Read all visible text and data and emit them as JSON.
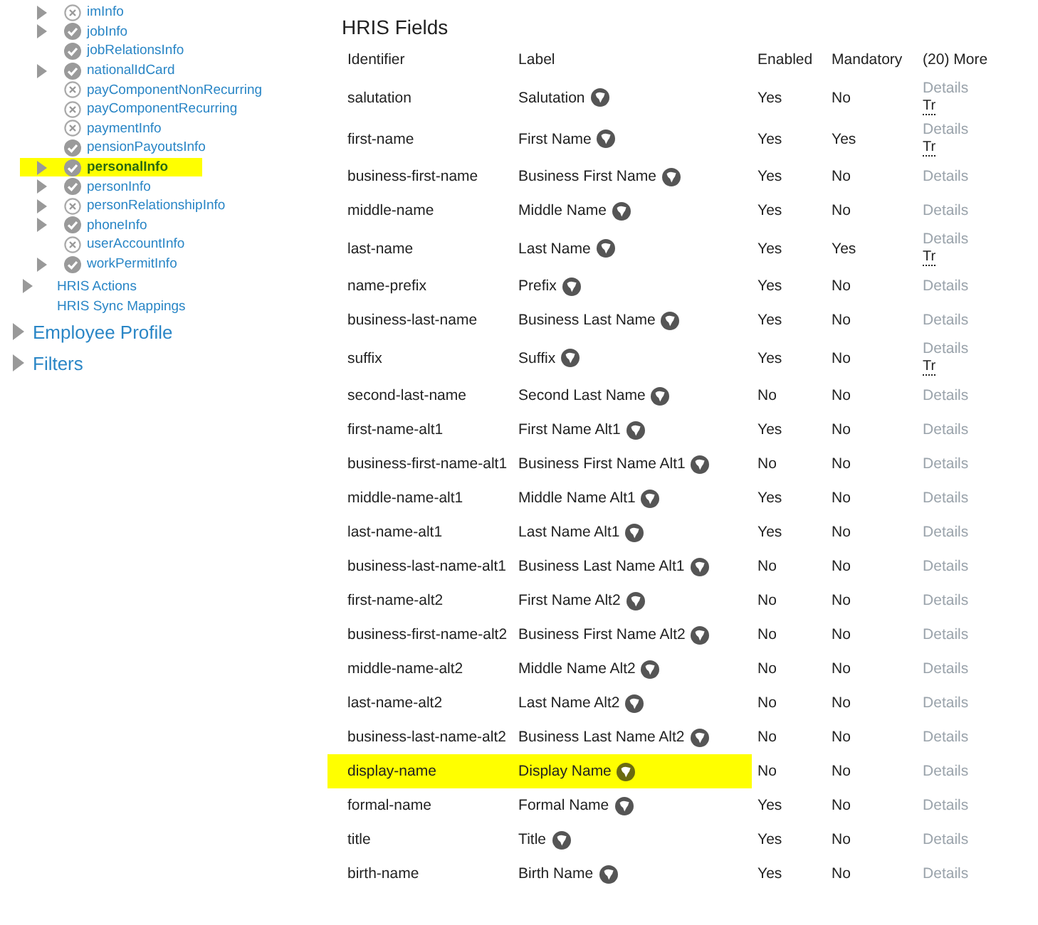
{
  "tree": {
    "entities": [
      {
        "name": "imInfo",
        "active": false,
        "expandable": true,
        "selected": false
      },
      {
        "name": "jobInfo",
        "active": true,
        "expandable": true,
        "selected": false
      },
      {
        "name": "jobRelationsInfo",
        "active": true,
        "expandable": false,
        "selected": false
      },
      {
        "name": "nationalIdCard",
        "active": true,
        "expandable": true,
        "selected": false
      },
      {
        "name": "payComponentNonRecurring",
        "active": false,
        "expandable": false,
        "selected": false
      },
      {
        "name": "payComponentRecurring",
        "active": false,
        "expandable": false,
        "selected": false
      },
      {
        "name": "paymentInfo",
        "active": false,
        "expandable": false,
        "selected": false
      },
      {
        "name": "pensionPayoutsInfo",
        "active": true,
        "expandable": false,
        "selected": false
      },
      {
        "name": "personalInfo",
        "active": true,
        "expandable": true,
        "selected": true
      },
      {
        "name": "personInfo",
        "active": true,
        "expandable": true,
        "selected": false
      },
      {
        "name": "personRelationshipInfo",
        "active": false,
        "expandable": true,
        "selected": false
      },
      {
        "name": "phoneInfo",
        "active": true,
        "expandable": true,
        "selected": false
      },
      {
        "name": "userAccountInfo",
        "active": false,
        "expandable": false,
        "selected": false
      },
      {
        "name": "workPermitInfo",
        "active": true,
        "expandable": true,
        "selected": false
      }
    ],
    "hris_items": [
      {
        "name": "HRIS Actions",
        "expandable": true
      },
      {
        "name": "HRIS Sync Mappings",
        "expandable": false
      }
    ],
    "sections": [
      {
        "name": "Employee Profile"
      },
      {
        "name": "Filters"
      }
    ]
  },
  "fields": {
    "title": "HRIS Fields",
    "columns": [
      "Identifier",
      "Label",
      "Enabled",
      "Mandatory",
      "(20) More"
    ],
    "rows": [
      {
        "identifier": "salutation",
        "label": "Salutation",
        "enabled": "Yes",
        "mandatory": "No",
        "details": "Details",
        "translation": "Tr",
        "selected": false
      },
      {
        "identifier": "first-name",
        "label": "First Name",
        "enabled": "Yes",
        "mandatory": "Yes",
        "details": "Details",
        "translation": "Tr",
        "selected": false
      },
      {
        "identifier": "business-first-name",
        "label": "Business First Name",
        "enabled": "Yes",
        "mandatory": "No",
        "details": "Details",
        "selected": false
      },
      {
        "identifier": "middle-name",
        "label": "Middle Name",
        "enabled": "Yes",
        "mandatory": "No",
        "details": "Details",
        "selected": false
      },
      {
        "identifier": "last-name",
        "label": "Last Name",
        "enabled": "Yes",
        "mandatory": "Yes",
        "details": "Details",
        "translation": "Tr",
        "selected": false
      },
      {
        "identifier": "name-prefix",
        "label": "Prefix",
        "enabled": "Yes",
        "mandatory": "No",
        "details": "Details",
        "selected": false
      },
      {
        "identifier": "business-last-name",
        "label": "Business Last Name",
        "enabled": "Yes",
        "mandatory": "No",
        "details": "Details",
        "selected": false
      },
      {
        "identifier": "suffix",
        "label": "Suffix",
        "enabled": "Yes",
        "mandatory": "No",
        "details": "Details",
        "translation": "Tr",
        "selected": false
      },
      {
        "identifier": "second-last-name",
        "label": "Second Last Name",
        "enabled": "No",
        "mandatory": "No",
        "details": "Details",
        "selected": false
      },
      {
        "identifier": "first-name-alt1",
        "label": "First Name Alt1",
        "enabled": "Yes",
        "mandatory": "No",
        "details": "Details",
        "selected": false
      },
      {
        "identifier": "business-first-name-alt1",
        "label": "Business First Name Alt1",
        "enabled": "No",
        "mandatory": "No",
        "details": "Details",
        "selected": false
      },
      {
        "identifier": "middle-name-alt1",
        "label": "Middle Name Alt1",
        "enabled": "Yes",
        "mandatory": "No",
        "details": "Details",
        "selected": false
      },
      {
        "identifier": "last-name-alt1",
        "label": "Last Name Alt1",
        "enabled": "Yes",
        "mandatory": "No",
        "details": "Details",
        "selected": false
      },
      {
        "identifier": "business-last-name-alt1",
        "label": "Business Last Name Alt1",
        "enabled": "No",
        "mandatory": "No",
        "details": "Details",
        "selected": false
      },
      {
        "identifier": "first-name-alt2",
        "label": "First Name Alt2",
        "enabled": "No",
        "mandatory": "No",
        "details": "Details",
        "selected": false
      },
      {
        "identifier": "business-first-name-alt2",
        "label": "Business First Name Alt2",
        "enabled": "No",
        "mandatory": "No",
        "details": "Details",
        "selected": false
      },
      {
        "identifier": "middle-name-alt2",
        "label": "Middle Name Alt2",
        "enabled": "No",
        "mandatory": "No",
        "details": "Details",
        "selected": false
      },
      {
        "identifier": "last-name-alt2",
        "label": "Last Name Alt2",
        "enabled": "No",
        "mandatory": "No",
        "details": "Details",
        "selected": false
      },
      {
        "identifier": "business-last-name-alt2",
        "label": "Business Last Name Alt2",
        "enabled": "No",
        "mandatory": "No",
        "details": "Details",
        "selected": false
      },
      {
        "identifier": "display-name",
        "label": "Display Name",
        "enabled": "No",
        "mandatory": "No",
        "details": "Details",
        "selected": true
      },
      {
        "identifier": "formal-name",
        "label": "Formal Name",
        "enabled": "Yes",
        "mandatory": "No",
        "details": "Details",
        "selected": false
      },
      {
        "identifier": "title",
        "label": "Title",
        "enabled": "Yes",
        "mandatory": "No",
        "details": "Details",
        "selected": false
      },
      {
        "identifier": "birth-name",
        "label": "Birth Name",
        "enabled": "Yes",
        "mandatory": "No",
        "details": "Details",
        "selected": false
      }
    ]
  }
}
